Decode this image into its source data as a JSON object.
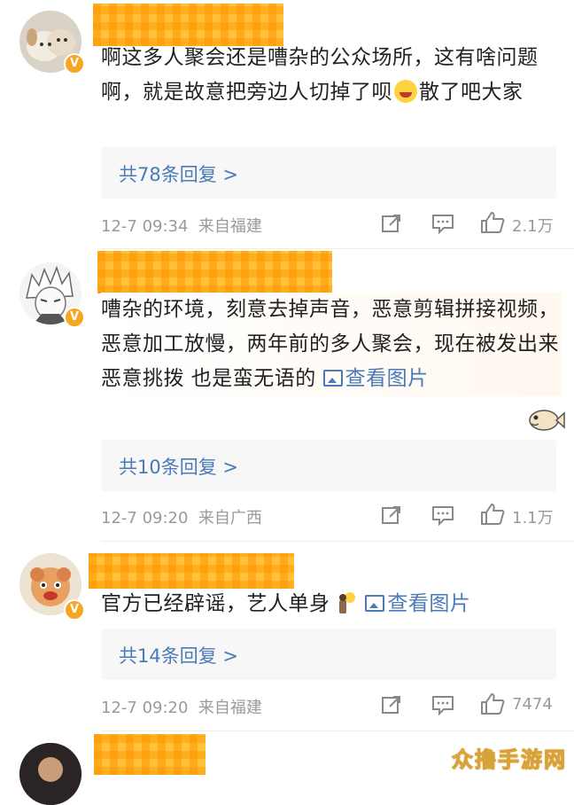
{
  "comments": [
    {
      "text_a": "啊这多人聚会还是嘈杂的公众场所，这有啥问题啊，就是故意把旁边人切掉了呗",
      "text_b": "散了吧大家",
      "reply": "共78条回复 >",
      "time": "12-7 09:34",
      "source": "来自福建",
      "likes": "2.1万"
    },
    {
      "text": "嘈杂的环境，刻意去掉声音，恶意剪辑拼接视频，恶意加工放慢，两年前的多人聚会，现在被发出来恶意挑拨 也是蛮无语的",
      "link": "查看图片",
      "reply": "共10条回复 >",
      "time": "12-7 09:20",
      "source": "来自广西",
      "likes": "1.1万"
    },
    {
      "text": "官方已经辟谣，艺人单身",
      "link": "查看图片",
      "reply": "共14条回复 >",
      "time": "12-7 09:20",
      "source": "来自福建",
      "likes": "7474"
    }
  ],
  "verified_mark": "V",
  "watermark": "众撸手游网",
  "colors": {
    "link": "#4a7bb7",
    "meta": "#9a9a9a",
    "badge": "#f5a623",
    "redact": "#ffc23a"
  }
}
